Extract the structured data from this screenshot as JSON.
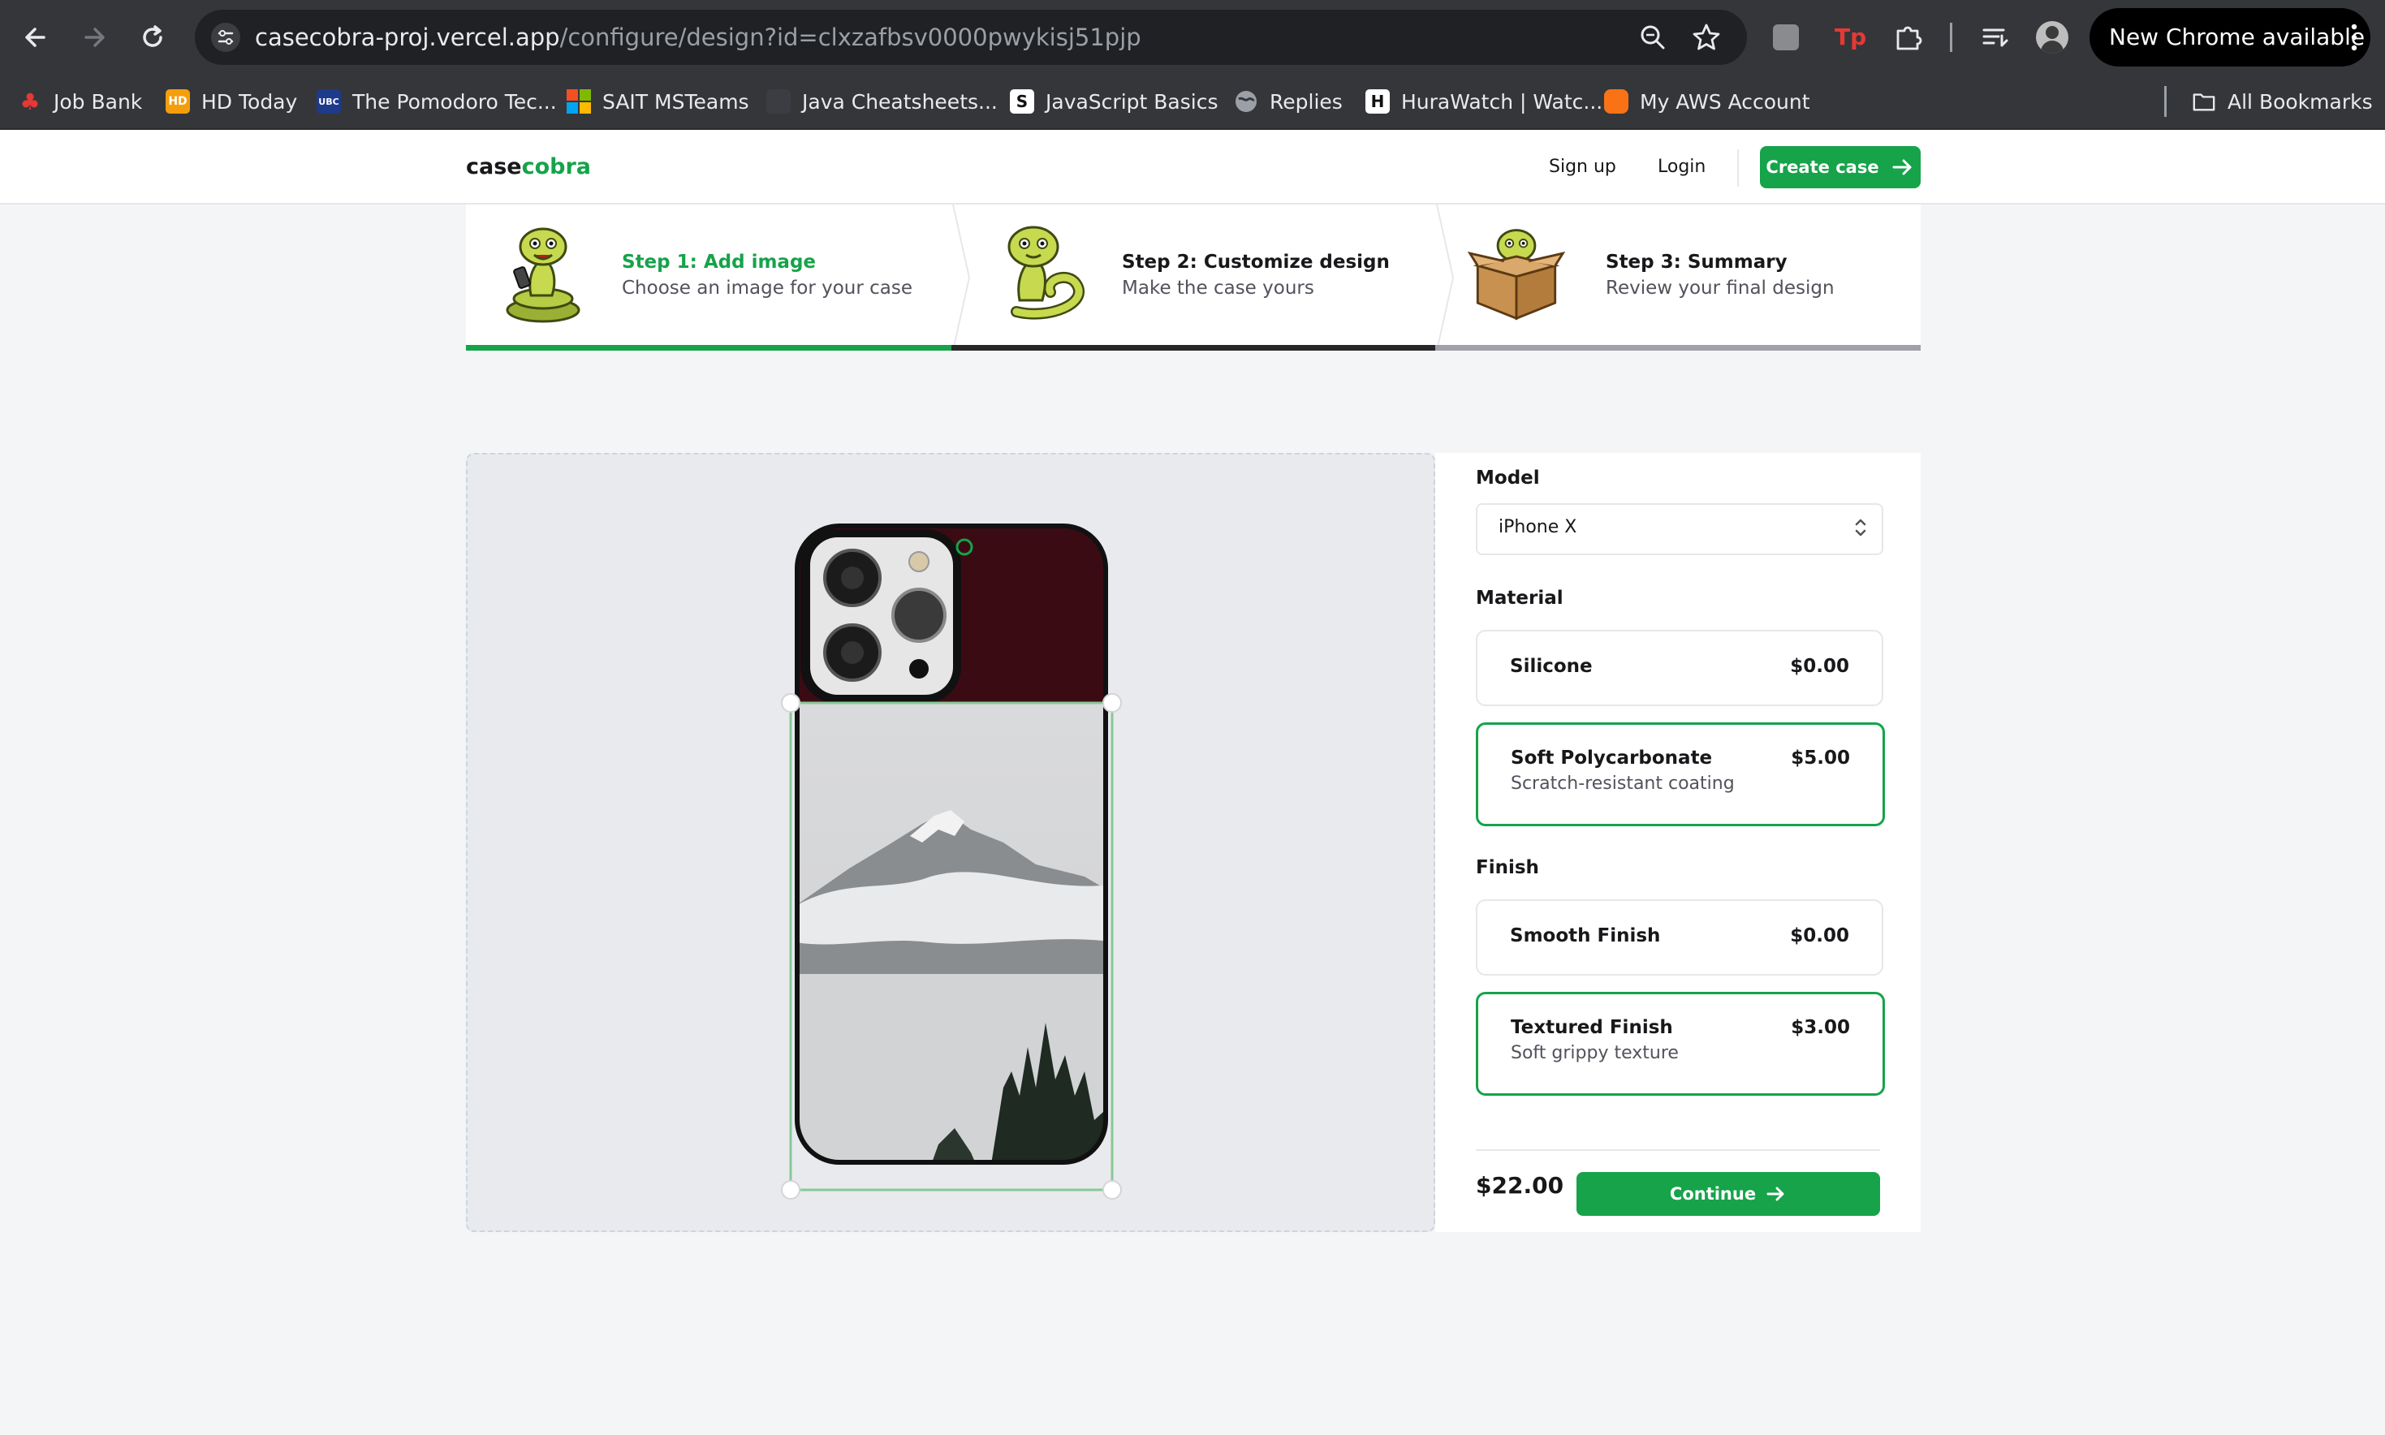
{
  "browser": {
    "url_host": "casecobra-proj.vercel.app",
    "url_path": "/configure/design?id=clxzafbsv0000pwykisj51pjp",
    "new_chrome_label": "New Chrome available",
    "bookmarks": [
      {
        "label": "Job Bank",
        "icon": "maple-leaf-icon"
      },
      {
        "label": "HD Today",
        "icon": "hd-icon"
      },
      {
        "label": "The Pomodoro Tec...",
        "icon": "ubc-icon"
      },
      {
        "label": "SAIT MSTeams",
        "icon": "microsoft-icon"
      },
      {
        "label": "Java Cheatsheets...",
        "icon": "java-icon"
      },
      {
        "label": "JavaScript Basics",
        "icon": "s-icon"
      },
      {
        "label": "Replies",
        "icon": "globe-icon"
      },
      {
        "label": "HuraWatch | Watc...",
        "icon": "h-icon"
      },
      {
        "label": "My AWS Account",
        "icon": "aws-icon"
      }
    ],
    "all_bookmarks_label": "All Bookmarks"
  },
  "header": {
    "logo_case": "case",
    "logo_cobra": "cobra",
    "signup": "Sign up",
    "login": "Login",
    "create_case": "Create case"
  },
  "steps": [
    {
      "title": "Step 1: Add image",
      "description": "Choose an image for your case",
      "state": "complete"
    },
    {
      "title": "Step 2: Customize design",
      "description": "Make the case yours",
      "state": "current"
    },
    {
      "title": "Step 3: Summary",
      "description": "Review your final design",
      "state": "upcoming"
    }
  ],
  "config": {
    "model_label": "Model",
    "model_value": "iPhone X",
    "material_label": "Material",
    "materials": [
      {
        "name": "Silicone",
        "price": "$0.00",
        "description": "",
        "selected": false
      },
      {
        "name": "Soft Polycarbonate",
        "price": "$5.00",
        "description": "Scratch-resistant coating",
        "selected": true
      }
    ],
    "finish_label": "Finish",
    "finishes": [
      {
        "name": "Smooth Finish",
        "price": "$0.00",
        "description": "",
        "selected": false
      },
      {
        "name": "Textured Finish",
        "price": "$3.00",
        "description": "Soft grippy texture",
        "selected": true
      }
    ],
    "total": "$22.00",
    "continue_label": "Continue"
  },
  "colors": {
    "accent": "#16a34a",
    "case_color": "#3b0b14",
    "chrome_bg": "#35363a"
  }
}
